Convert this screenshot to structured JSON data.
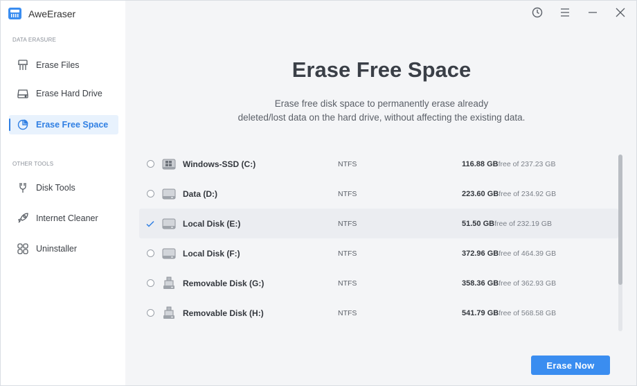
{
  "app": {
    "title": "AweEraser"
  },
  "sidebar": {
    "sections": [
      {
        "label": "DATA ERASURE",
        "items": [
          {
            "label": "Erase Files",
            "icon": "shredder-icon",
            "active": false
          },
          {
            "label": "Erase Hard Drive",
            "icon": "hard-drive-icon",
            "active": false
          },
          {
            "label": "Erase Free Space",
            "icon": "pie-chart-icon",
            "active": true
          }
        ]
      },
      {
        "label": "OTHER TOOLS",
        "items": [
          {
            "label": "Disk Tools",
            "icon": "wrench-icon",
            "active": false
          },
          {
            "label": "Internet Cleaner",
            "icon": "rocket-icon",
            "active": false
          },
          {
            "label": "Uninstaller",
            "icon": "apps-grid-icon",
            "active": false
          }
        ]
      }
    ]
  },
  "window_controls": [
    "history-icon",
    "menu-icon",
    "minimize-icon",
    "close-icon"
  ],
  "main": {
    "title": "Erase Free Space",
    "description_line1": "Erase free disk space to permanently erase already",
    "description_line2": "deleted/lost data on the hard drive, without affecting the existing data.",
    "drives": [
      {
        "name": "Windows-SSD (C:)",
        "fs": "NTFS",
        "free": "116.88 GB",
        "total_text": "free of 237.23 GB",
        "icon": "windows-drive-icon",
        "selected": false
      },
      {
        "name": "Data (D:)",
        "fs": "NTFS",
        "free": "223.60 GB",
        "total_text": "free of 234.92 GB",
        "icon": "hard-disk-icon",
        "selected": false
      },
      {
        "name": "Local Disk (E:)",
        "fs": "NTFS",
        "free": "51.50 GB",
        "total_text": "free of 232.19 GB",
        "icon": "hard-disk-icon",
        "selected": true
      },
      {
        "name": "Local Disk (F:)",
        "fs": "NTFS",
        "free": "372.96 GB",
        "total_text": "free of 464.39 GB",
        "icon": "hard-disk-icon",
        "selected": false
      },
      {
        "name": "Removable Disk (G:)",
        "fs": "NTFS",
        "free": "358.36 GB",
        "total_text": "free of 362.93 GB",
        "icon": "usb-drive-icon",
        "selected": false
      },
      {
        "name": "Removable Disk (H:)",
        "fs": "NTFS",
        "free": "541.79 GB",
        "total_text": "free of 568.58 GB",
        "icon": "usb-drive-icon",
        "selected": false
      }
    ],
    "action_button": "Erase Now"
  },
  "colors": {
    "accent": "#3a8df0",
    "active_bg": "#e8f2fd",
    "active_text": "#2f7fe3"
  }
}
